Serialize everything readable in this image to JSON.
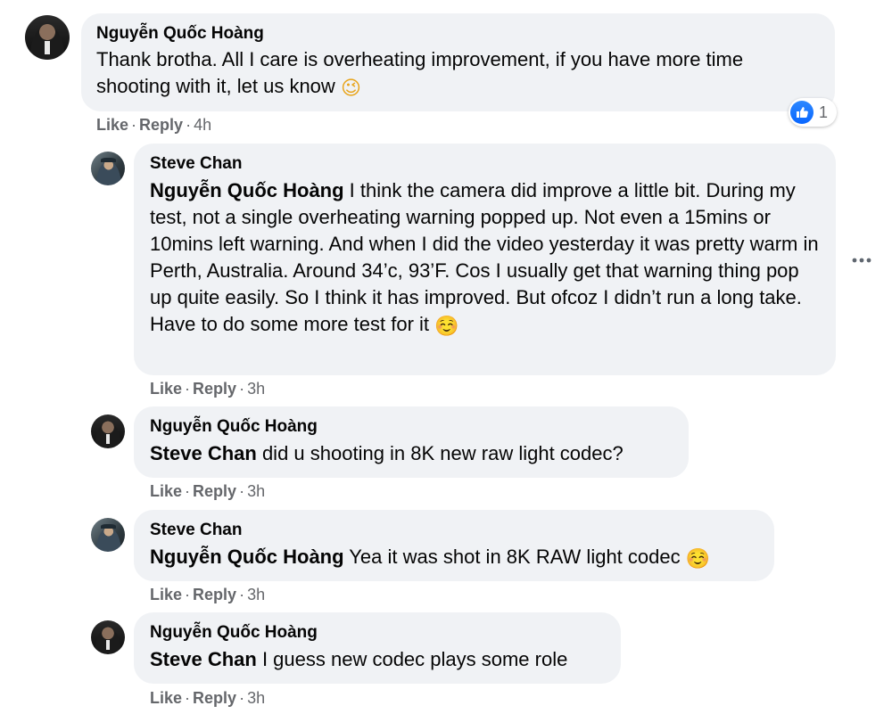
{
  "colors": {
    "bubble": "#f0f2f5",
    "meta_text": "#65676b",
    "text": "#050505",
    "like_blue": "#0866ff"
  },
  "comments": [
    {
      "author": "Nguyễn Quốc Hoàng",
      "mention": "",
      "text": "Thank brotha. All I care is overheating improvement, if you have more time shooting with it, let us know",
      "emoji": "😉",
      "like_label": "Like",
      "reply_label": "Reply",
      "separator": "·",
      "time": "4h",
      "reaction_icon": "thumbs-up-icon",
      "reaction_count": "1"
    },
    {
      "author": "Steve Chan",
      "mention": "Nguyễn Quốc Hoàng",
      "text": " I think the camera did improve a little bit. During my test, not a single overheating warning popped up. Not even a 15mins or 10mins left warning. And when I did the video yesterday it was pretty warm in Perth, Australia. Around 34’c, 93’F. Cos I usually get that warning thing pop up quite easily. So I think it has improved. But ofcoz I didn’t run a long take. Have to do some more test for it",
      "emoji": "☺️",
      "like_label": "Like",
      "reply_label": "Reply",
      "separator": "·",
      "time": "3h"
    },
    {
      "author": "Nguyễn Quốc Hoàng",
      "mention": "Steve Chan",
      "text": " did u shooting in 8K new raw light codec?",
      "emoji": "",
      "like_label": "Like",
      "reply_label": "Reply",
      "separator": "·",
      "time": "3h"
    },
    {
      "author": "Steve Chan",
      "mention": "Nguyễn Quốc Hoàng",
      "text": " Yea it was shot in 8K RAW light codec",
      "emoji": "☺️",
      "like_label": "Like",
      "reply_label": "Reply",
      "separator": "·",
      "time": "3h"
    },
    {
      "author": "Nguyễn Quốc Hoàng",
      "mention": "Steve Chan",
      "text": " I guess new codec plays some role",
      "emoji": "",
      "like_label": "Like",
      "reply_label": "Reply",
      "separator": "·",
      "time": "3h"
    }
  ],
  "icons": {
    "more": "more-options-icon"
  }
}
